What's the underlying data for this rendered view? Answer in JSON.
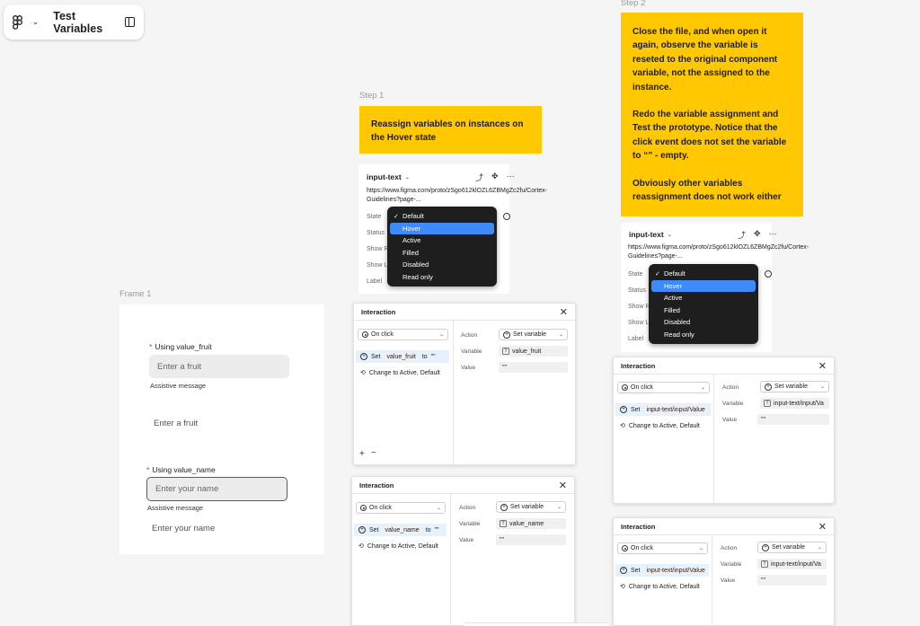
{
  "topbar": {
    "title": "Test Variables"
  },
  "labels": {
    "step1": "Step 1",
    "step2": "Step 2",
    "frame1": "Frame 1"
  },
  "sticky1": {
    "text": "Reassign variables on instances on the Hover state"
  },
  "sticky2": {
    "p1": "Close the file, and when open it again, observe the variable is reseted to the original component variable, not the assigned to the instance.",
    "p2": "Redo the variable assignment and Test the prototype. Notice that the click event does not set the variable to “” - empty.",
    "p3": "Obviously other variables reassignment does not work either"
  },
  "frame1": {
    "field1": {
      "label": "Using value_fruit",
      "placeholder": "Enter a fruit",
      "assist": "Assistive message"
    },
    "plain1": "Enter a fruit",
    "field2": {
      "label": "Using value_name",
      "placeholder": "Enter your name",
      "assist": "Assistive message"
    },
    "plain2": "Enter your name"
  },
  "prop": {
    "name": "input-text",
    "url": "https://www.figma.com/proto/zSgo612klOZL6ZBMgZc2fu/Cortex-Guidelines?page-...",
    "rows": [
      "State",
      "Status",
      "Show Re",
      "Show La",
      "Label"
    ],
    "menu": [
      "Default",
      "Hover",
      "Active",
      "Filled",
      "Disabled",
      "Read only"
    ],
    "checked": "Default",
    "selected": "Hover"
  },
  "panels": [
    {
      "title": "Interaction",
      "trigger": "On click",
      "set_label": "Set",
      "var": "value_fruit",
      "to": "to",
      "val": "\"\"",
      "change": "Change to Active, Default",
      "action_label": "Action",
      "action": "Set variable",
      "variable_label": "Variable",
      "variable": "value_fruit",
      "value_label": "Value",
      "value": "\"\""
    },
    {
      "title": "Interaction",
      "trigger": "On click",
      "set_label": "Set",
      "var": "value_name",
      "to": "to",
      "val": "\"\"",
      "change": "Change to Active, Default",
      "action_label": "Action",
      "action": "Set variable",
      "variable_label": "Variable",
      "variable": "value_name",
      "value_label": "Value",
      "value": "\"\""
    },
    {
      "title": "Interaction",
      "trigger": "On click",
      "set_label": "Set",
      "var": "input-text/input/Value",
      "change": "Change to Active, Default",
      "action_label": "Action",
      "action": "Set variable",
      "variable_label": "Variable",
      "variable": "input-text/input/Va",
      "value_label": "Value",
      "value": "\"\""
    },
    {
      "title": "Interaction",
      "trigger": "On click",
      "set_label": "Set",
      "var": "input-text/input/Value",
      "change": "Change to Active, Default",
      "action_label": "Action",
      "action": "Set variable",
      "variable_label": "Variable",
      "variable": "input-text/input/Va",
      "value_label": "Value",
      "value": "\"\""
    }
  ]
}
